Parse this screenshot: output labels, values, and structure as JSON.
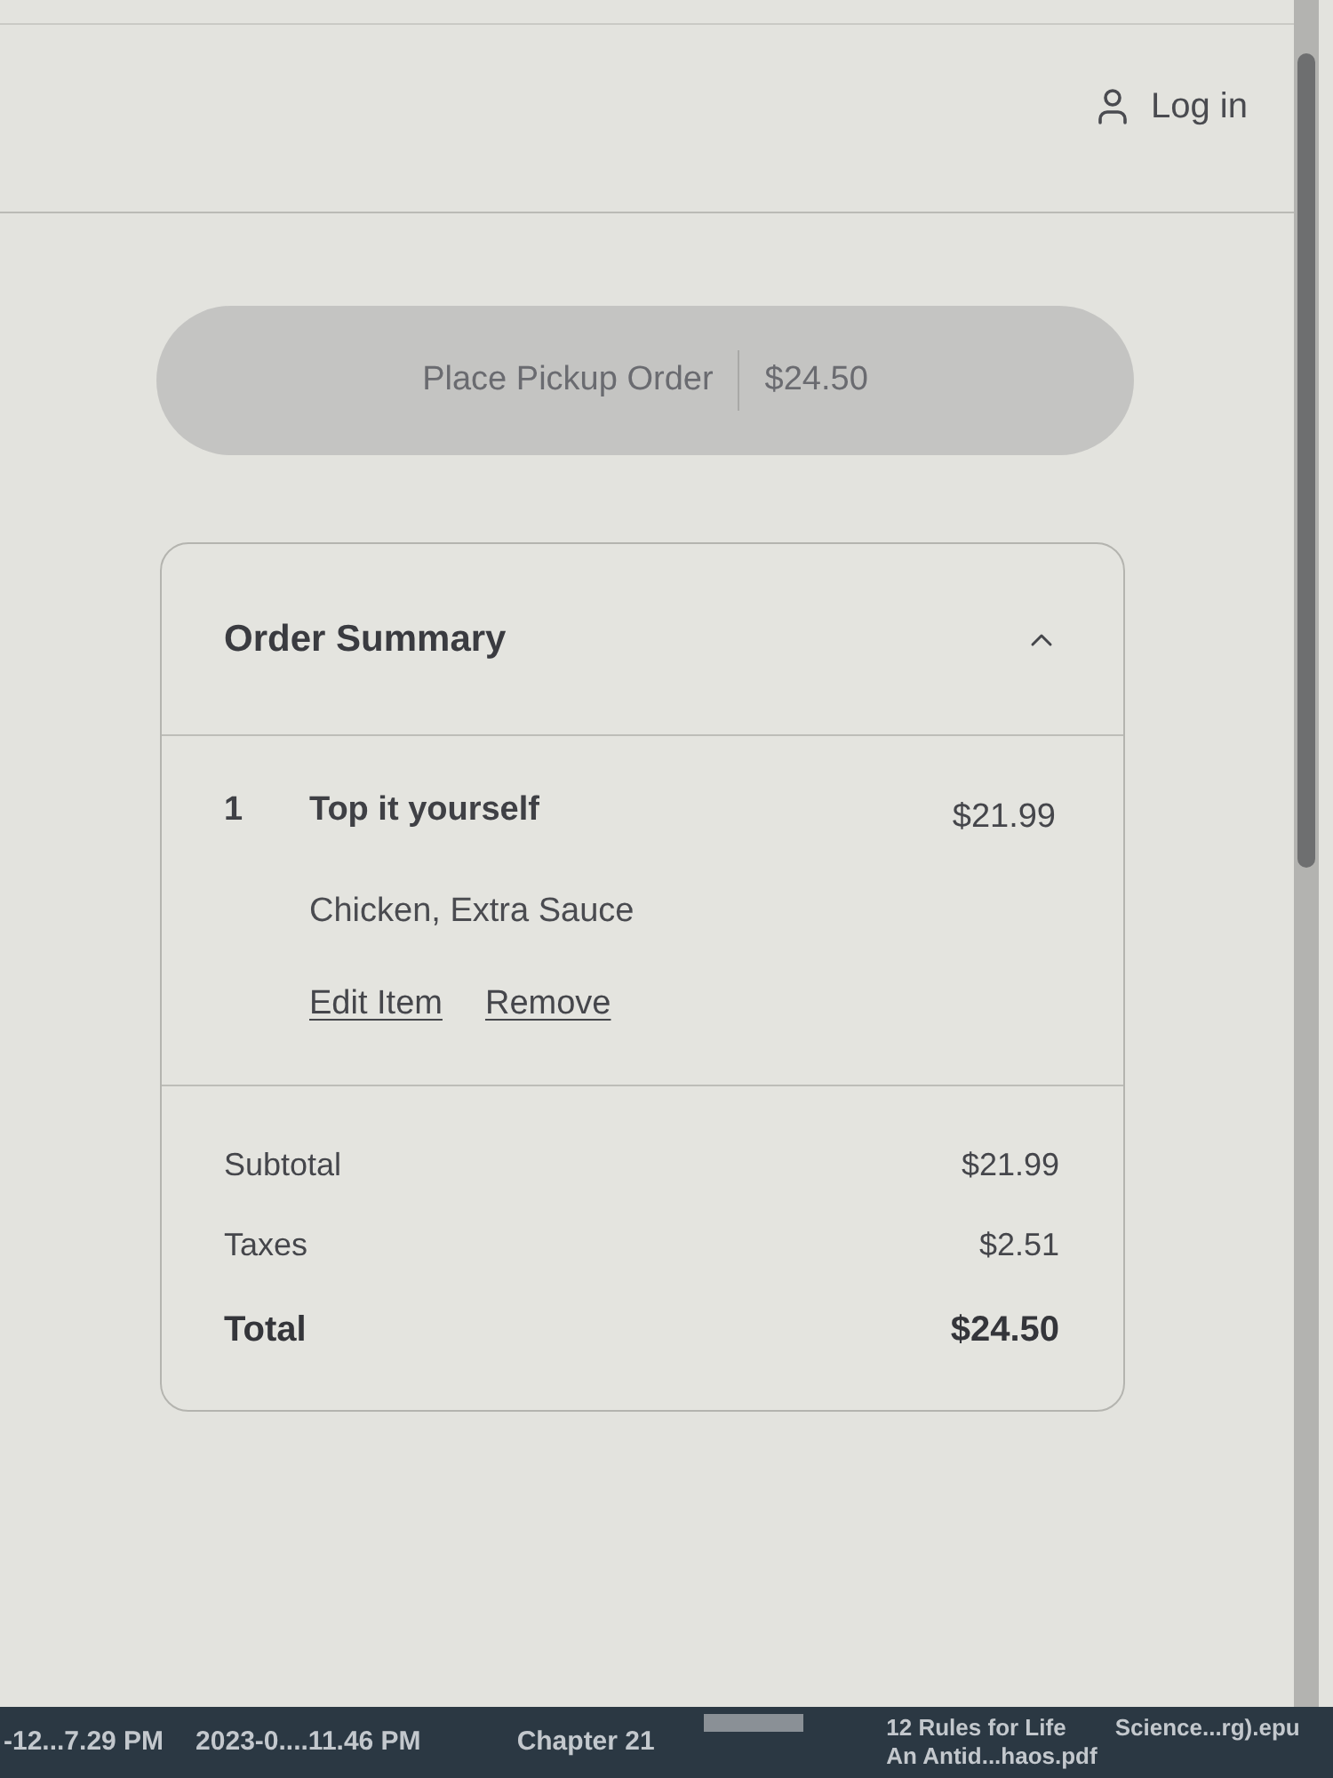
{
  "header": {
    "login": "Log in"
  },
  "checkout_button": {
    "label": "Place Pickup Order",
    "amount": "$24.50",
    "disabled": true
  },
  "order_summary": {
    "title": "Order Summary",
    "expanded": true,
    "items": [
      {
        "quantity": "1",
        "name": "Top it yourself",
        "price": "$21.99",
        "options": "Chicken, Extra Sauce",
        "actions": [
          "Edit Item",
          "Remove"
        ]
      }
    ],
    "totals": [
      {
        "kind": "normal",
        "label": "Subtotal",
        "amount": "$21.99"
      },
      {
        "kind": "normal",
        "label": "Taxes",
        "amount": "$2.51"
      },
      {
        "kind": "grand",
        "label": "Total",
        "amount": "$24.50"
      }
    ]
  },
  "taskbar": {
    "items": [
      "-12...7.29 PM",
      "2023-0....11.46 PM",
      "Chapter 21"
    ],
    "files": [
      "12 Rules for Life",
      "Science...rg).epu",
      "An Antid...haos.pdf"
    ]
  }
}
